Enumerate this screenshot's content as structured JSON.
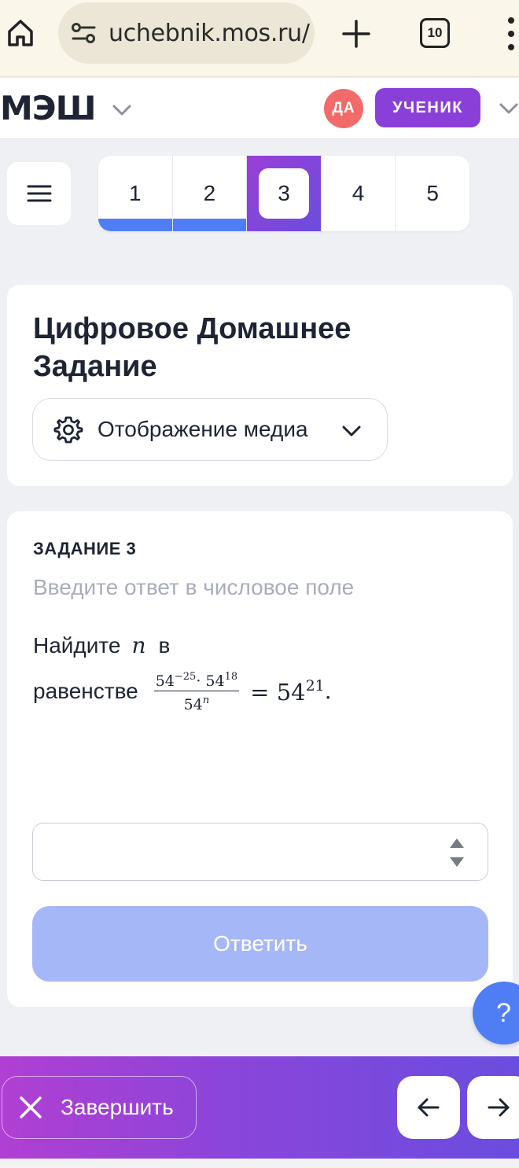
{
  "browser": {
    "url": "uchebnik.mos.ru/",
    "tab_count": "10"
  },
  "header": {
    "logo": "МЭШ",
    "avatar_initials": "ДА",
    "role": "УЧЕНИК"
  },
  "task_nav": {
    "tabs": [
      {
        "label": "1",
        "state": "done"
      },
      {
        "label": "2",
        "state": "done"
      },
      {
        "label": "3",
        "state": "active"
      },
      {
        "label": "4",
        "state": "pending"
      },
      {
        "label": "5",
        "state": "pending"
      }
    ]
  },
  "intro_card": {
    "title": "Цифровое Домашнее Задание",
    "media_button": "Отображение медиа"
  },
  "task": {
    "label": "ЗАДАНИЕ 3",
    "hint": "Введите ответ в числовое поле",
    "text_part1": "Найдите",
    "variable": "n",
    "text_part2": "в",
    "text_part3": "равенстве",
    "formula": {
      "num_base1": "54",
      "num_exp1": "−25",
      "dot": "·",
      "num_base2": "54",
      "num_exp2": "18",
      "den_base": "54",
      "den_exp": "n",
      "equals": "=",
      "rhs_base": "54",
      "rhs_exp": "21",
      "period": "."
    },
    "answer_value": "",
    "submit_label": "Ответить"
  },
  "help": {
    "label": "?"
  },
  "bottom_bar": {
    "finish_label": "Завершить"
  },
  "colors": {
    "accent_blue": "#4f7df3",
    "accent_purple": "#8b3fd9",
    "avatar_red": "#f36a6a",
    "submit_disabled": "#a6b7f7"
  }
}
